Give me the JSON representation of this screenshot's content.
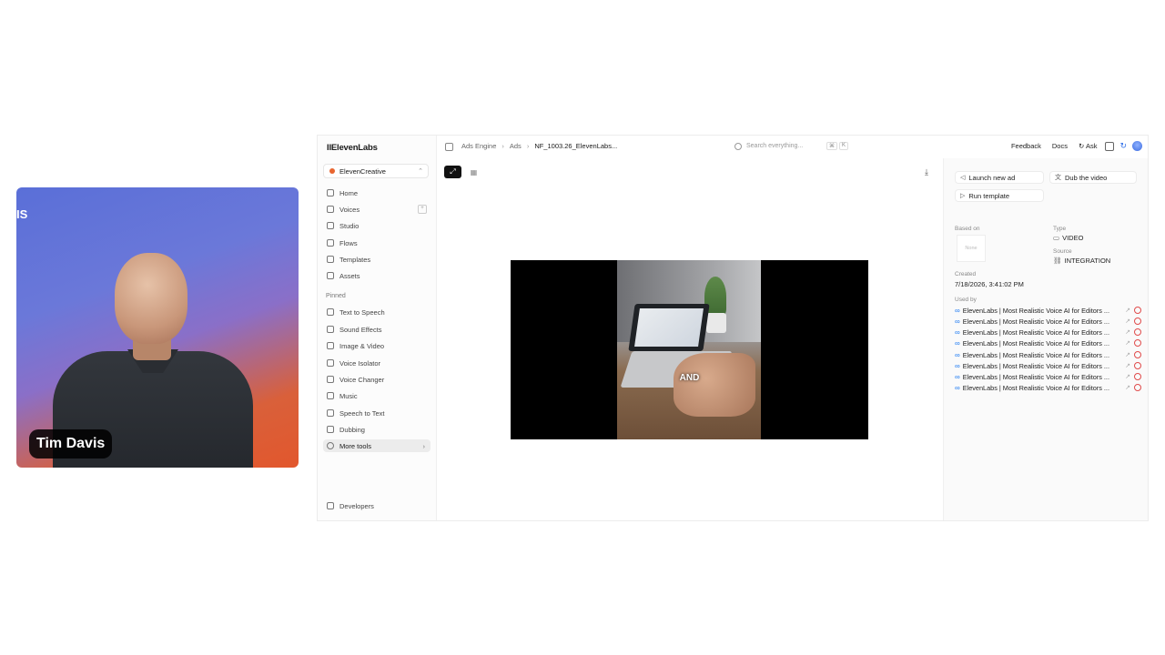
{
  "webcam": {
    "bg_text": "IS",
    "name": "Tim Davis"
  },
  "app": {
    "logo": "IIElevenLabs",
    "workspace": "ElevenCreative",
    "nav": [
      {
        "label": "Home",
        "icon": "home-icon"
      },
      {
        "label": "Voices",
        "icon": "voices-icon"
      },
      {
        "label": "Studio",
        "icon": "studio-icon"
      },
      {
        "label": "Flows",
        "icon": "flows-icon"
      },
      {
        "label": "Templates",
        "icon": "templates-icon"
      },
      {
        "label": "Assets",
        "icon": "assets-icon"
      }
    ],
    "pinned_label": "Pinned",
    "pinned": [
      {
        "label": "Text to Speech",
        "icon": "text-to-speech-icon"
      },
      {
        "label": "Sound Effects",
        "icon": "sound-effects-icon"
      },
      {
        "label": "Image & Video",
        "icon": "image-video-icon"
      },
      {
        "label": "Voice Isolator",
        "icon": "voice-isolator-icon"
      },
      {
        "label": "Voice Changer",
        "icon": "voice-changer-icon"
      },
      {
        "label": "Music",
        "icon": "music-icon"
      },
      {
        "label": "Speech to Text",
        "icon": "speech-to-text-icon"
      },
      {
        "label": "Dubbing",
        "icon": "dubbing-icon"
      },
      {
        "label": "More tools",
        "icon": "more-tools-icon"
      }
    ],
    "developers": "Developers"
  },
  "topbar": {
    "breadcrumbs": [
      "Ads Engine",
      "Ads",
      "NF_1003.26_ElevenLabs..."
    ],
    "search_placeholder": "Search everything...",
    "kbd": [
      "⌘",
      "K"
    ],
    "feedback": "Feedback",
    "docs": "Docs",
    "ask": "Ask"
  },
  "video": {
    "caption": "AND"
  },
  "right_panel": {
    "launch_new_ad": "Launch new ad",
    "dub_the_video": "Dub the video",
    "run_template": "Run template",
    "based_on_label": "Based on",
    "based_on_thumb": "None",
    "type_label": "Type",
    "type_value": "VIDEO",
    "source_label": "Source",
    "source_value": "INTEGRATION",
    "created_label": "Created",
    "created_value": "7/18/2026, 3:41:02 PM",
    "used_by_label": "Used by",
    "used_by": [
      "ElevenLabs | Most Realistic Voice AI for Editors ...",
      "ElevenLabs | Most Realistic Voice AI for Editors ...",
      "ElevenLabs | Most Realistic Voice AI for Editors ...",
      "ElevenLabs | Most Realistic Voice AI for Editors ...",
      "ElevenLabs | Most Realistic Voice AI for Editors ...",
      "ElevenLabs | Most Realistic Voice AI for Editors ...",
      "ElevenLabs | Most Realistic Voice AI for Editors ...",
      "ElevenLabs | Most Realistic Voice AI for Editors ..."
    ]
  }
}
